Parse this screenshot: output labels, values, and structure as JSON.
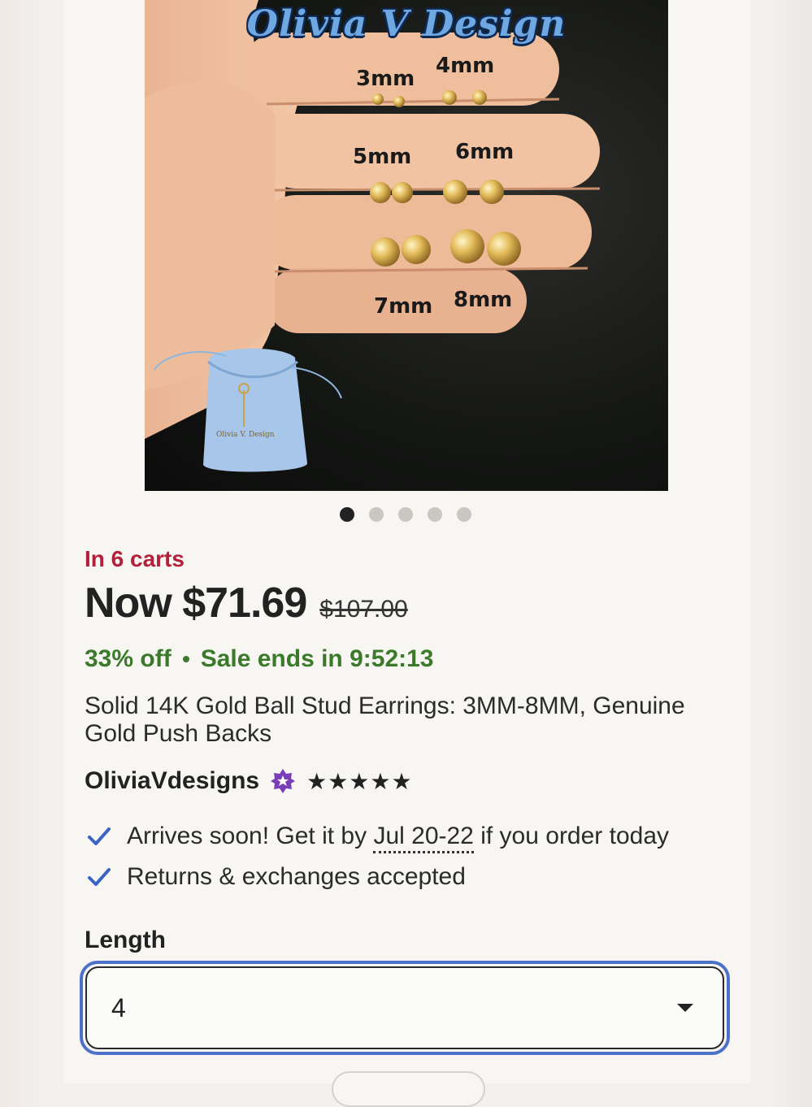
{
  "gallery": {
    "brand_overlay": "Olivia V Design",
    "sizes": [
      "3mm",
      "4mm",
      "5mm",
      "6mm",
      "7mm",
      "8mm"
    ],
    "pouch_text": "Olivia V. Design",
    "dot_count": 5,
    "active_index": 0
  },
  "listing": {
    "in_carts": "In 6 carts",
    "price_now": "Now $71.69",
    "price_original": "$107.00",
    "discount": "33% off",
    "sale_timer": "Sale ends in 9:52:13",
    "title": "Solid 14K Gold Ball Stud Earrings: 3MM-8MM, Genuine Gold Push Backs"
  },
  "shop": {
    "name": "OliviaVdesigns",
    "rating_stars": "★★★★★",
    "rating_value": 5
  },
  "features": {
    "delivery_prefix": "Arrives soon! Get it by",
    "delivery_date": "Jul 20-22",
    "delivery_suffix": "if you order today",
    "returns": "Returns & exchanges accepted"
  },
  "options": {
    "length_label": "Length",
    "length_value": "4"
  },
  "colors": {
    "in_carts": "#b3203a",
    "sale": "#3b7a2a",
    "check": "#3a64c4",
    "focus_ring": "#4d71c9",
    "star_seller": "#7a3fb8"
  }
}
